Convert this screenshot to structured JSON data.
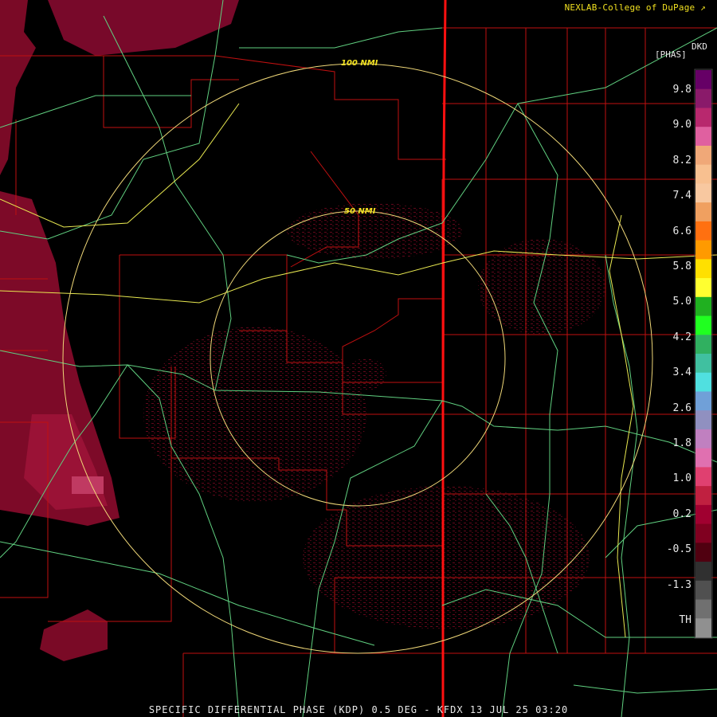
{
  "credit": "NEXLAB-College of DuPage",
  "product_code": "DKD",
  "units": "[PHAS]",
  "legend": {
    "labels": [
      "9.8",
      "9.0",
      "8.2",
      "7.4",
      "6.6",
      "5.8",
      "5.0",
      "4.2",
      "3.4",
      "2.6",
      "1.8",
      "1.0",
      "0.2",
      "-0.5",
      "-1.3",
      "TH"
    ],
    "colors": [
      "#660066",
      "#8a1a6a",
      "#b8286e",
      "#e060a0",
      "#f0a878",
      "#f8c090",
      "#f8c8a0",
      "#f0a060",
      "#ff7010",
      "#ff9a00",
      "#ffe000",
      "#ffff30",
      "#20b020",
      "#20ff20",
      "#30b060",
      "#40c0a0",
      "#50e0e0",
      "#70a0d8",
      "#9090c0",
      "#c080c0",
      "#e070b0",
      "#e04070",
      "#c02040",
      "#a00030",
      "#800020",
      "#500010",
      "#303030",
      "#505050",
      "#707070",
      "#909090"
    ]
  },
  "rings": [
    {
      "label": "50 NMI",
      "radius_nmi": 50
    },
    {
      "label": "100 NMI",
      "radius_nmi": 100
    }
  ],
  "footer": "SPECIFIC DIFFERENTIAL PHASE (KDP) 0.5 DEG - KFDX 13 JUL 25 03:20"
}
